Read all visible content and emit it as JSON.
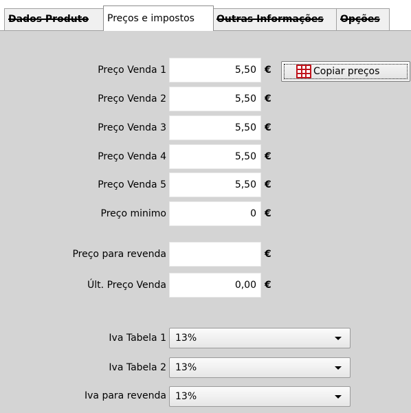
{
  "tabs": [
    {
      "label": "Dados Produto",
      "state": "struck"
    },
    {
      "label": "Preços e impostos",
      "state": "active"
    },
    {
      "label": "Outras Informações",
      "state": "struck"
    },
    {
      "label": "Opções",
      "state": "struck"
    }
  ],
  "currency_symbol": "€",
  "prices": [
    {
      "label": "Preço Venda 1",
      "value": "5,50"
    },
    {
      "label": "Preço Venda 2",
      "value": "5,50"
    },
    {
      "label": "Preço Venda 3",
      "value": "5,50"
    },
    {
      "label": "Preço Venda 4",
      "value": "5,50"
    },
    {
      "label": "Preço Venda 5",
      "value": "5,50"
    },
    {
      "label": "Preço minimo",
      "value": "0"
    }
  ],
  "resale": {
    "label": "Preço para revenda",
    "value": ""
  },
  "last_price": {
    "label": "Últ. Preço Venda",
    "value": "0,00"
  },
  "copy_button": {
    "label": "Copiar preços",
    "icon": "table-grid-icon"
  },
  "vat": [
    {
      "label": "Iva Tabela 1",
      "value": "13%"
    },
    {
      "label": "Iva Tabela 2",
      "value": "13%"
    },
    {
      "label": "Iva para revenda",
      "value": "13%"
    }
  ],
  "colors": {
    "panel": "#d4d4d4",
    "icon_red": "#c0141c"
  }
}
